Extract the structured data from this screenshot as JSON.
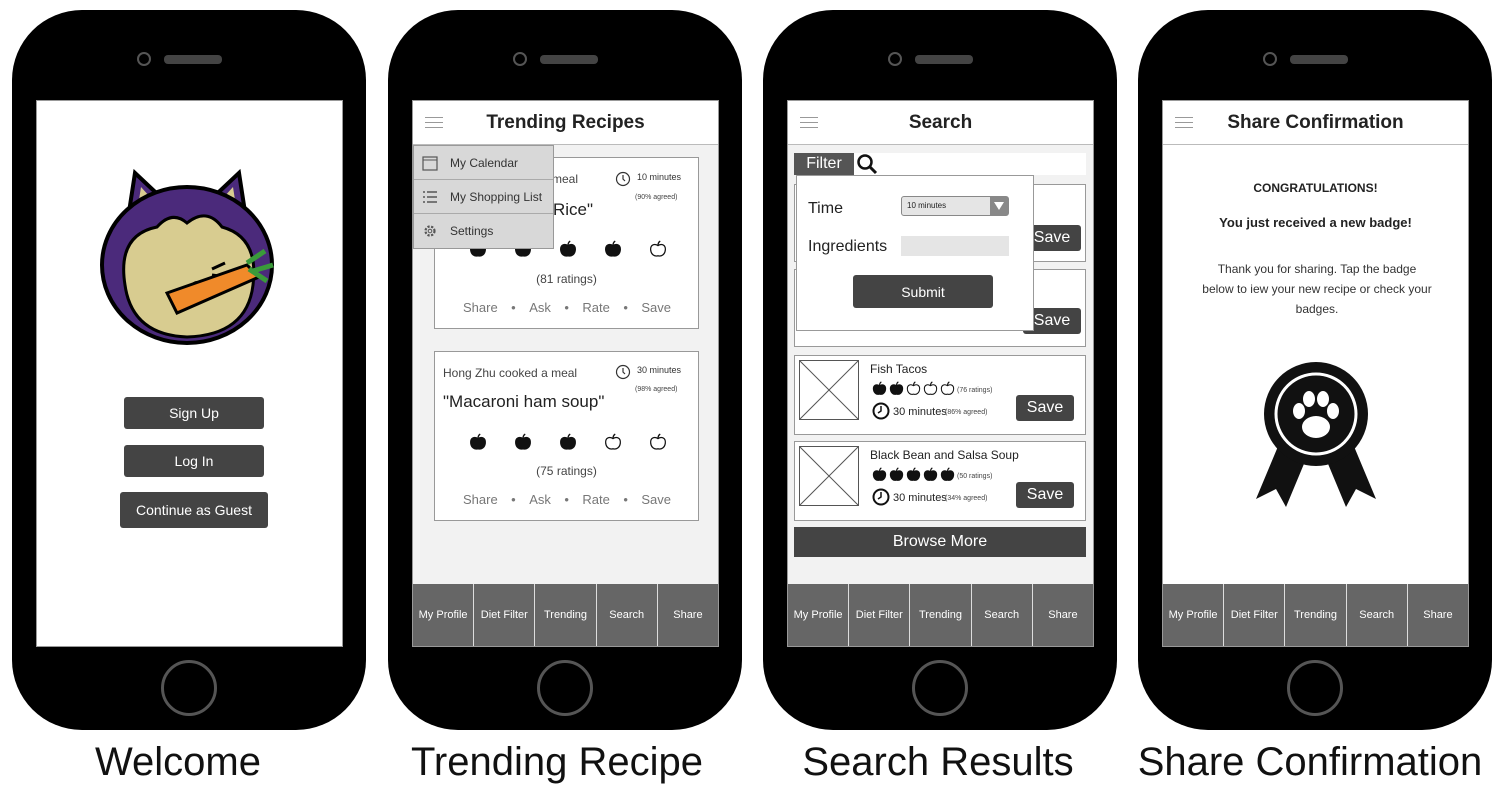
{
  "phones": {
    "welcome": {
      "caption": "Welcome",
      "sign_up": "Sign Up",
      "log_in": "Log In",
      "guest": "Continue as Guest"
    },
    "trending": {
      "caption": "Trending Recipe",
      "title": "Trending Recipes",
      "menu": [
        "My Calendar",
        "My Shopping List",
        "Settings"
      ],
      "card1": {
        "author_fragment": "meal",
        "time": "10 minutes",
        "agreed": "(90% agreed)",
        "title_fragment": "Rice\"",
        "ratings": "(81 ratings)",
        "rating_value": 4
      },
      "card2": {
        "author": "Hong Zhu cooked a meal",
        "time": "30 minutes",
        "agreed": "(98% agreed)",
        "title": "\"Macaroni ham soup\"",
        "ratings": "(75 ratings)",
        "rating_value": 3
      },
      "actions": [
        "Share",
        "Ask",
        "Rate",
        "Save"
      ]
    },
    "search": {
      "caption": "Search Results",
      "title": "Search",
      "filter": "Filter",
      "time_label": "Time",
      "time_value": "10 minutes",
      "ingredients_label": "Ingredients",
      "submit": "Submit",
      "save": "Save",
      "result1": {
        "name": "Fish Tacos",
        "ratings": "(76 ratings)",
        "time": "30 minutes",
        "agreed": "(86% agreed)",
        "rating_value": 2
      },
      "result2": {
        "name": "Black Bean and Salsa Soup",
        "ratings": "(50 ratings)",
        "time": "30 minutes",
        "agreed": "(34% agreed)",
        "rating_value": 5
      },
      "browse_more": "Browse More"
    },
    "share": {
      "caption": "Share Confirmation",
      "title": "Share Confirmation",
      "congrats": "CONGRATULATIONS!",
      "badge_msg": "You just received a new badge!",
      "body": "Thank you for sharing. Tap the badge below to iew your new recipe or check your badges."
    }
  },
  "tabs": [
    "My Profile",
    "Diet Filter",
    "Trending",
    "Search",
    "Share"
  ],
  "colors": {
    "mascot_purple": "#4b2a7b",
    "mascot_tan": "#d8cc90",
    "button_dark": "#444444",
    "tabbar": "#666666"
  }
}
